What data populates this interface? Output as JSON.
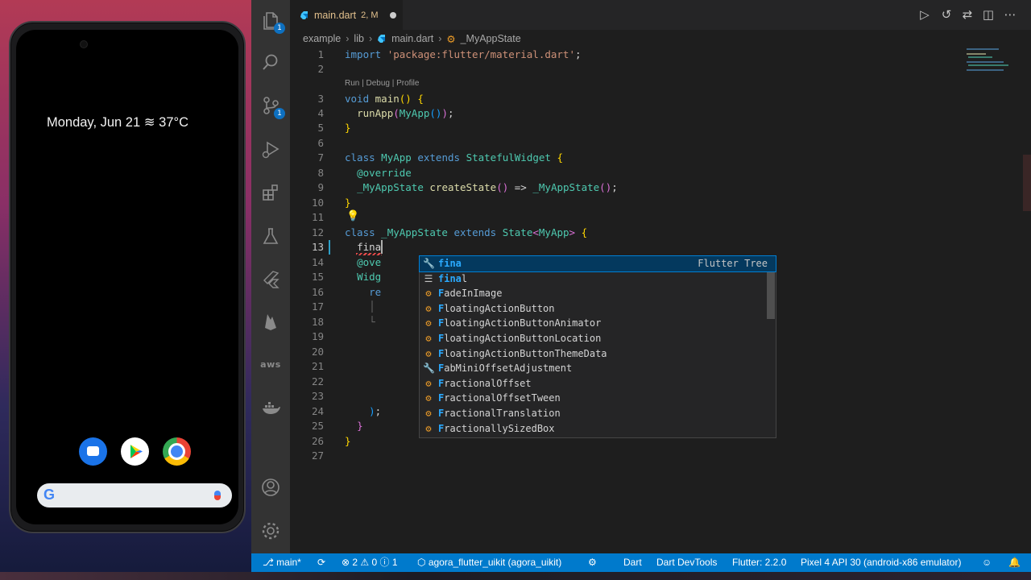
{
  "phone": {
    "date_weather": "Monday, Jun 21 ≋ 37°C",
    "dock_apps": [
      "messages-icon",
      "play-store-icon",
      "chrome-icon"
    ],
    "search_logo": "G"
  },
  "activity_bar": {
    "explorer_badge": "1",
    "source_control_badge": "1",
    "aws_label": "aws"
  },
  "editor_tab": {
    "filename": "main.dart",
    "status": "2, M"
  },
  "breadcrumb": [
    "example",
    "lib",
    "main.dart",
    "_MyAppState"
  ],
  "code": {
    "line_numbers": [
      "1",
      "2",
      "3",
      "4",
      "5",
      "6",
      "7",
      "8",
      "9",
      "10",
      "11",
      "12",
      "13",
      "14",
      "15",
      "16",
      "17",
      "18",
      "19",
      "20",
      "21",
      "22",
      "23",
      "24",
      "25",
      "26",
      "27"
    ],
    "codelens": "Run | Debug | Profile",
    "line1_import": "import",
    "line1_string": "'package:flutter/material.dart'",
    "line3_void": "void",
    "line3_main": "main",
    "line4_runapp": "runApp",
    "line4_myapp": "MyApp",
    "line7_class": "class",
    "line7_name": "MyApp",
    "line7_extends": "extends",
    "line7_super": "StatefulWidget",
    "line8_override": "@override",
    "line9_type": "_MyAppState",
    "line9_method": "createState",
    "line9_arrow": "=>",
    "line9_ctor": "_MyAppState",
    "line12_class": "class",
    "line12_name": "_MyAppState",
    "line12_extends": "extends",
    "line12_super": "State",
    "line12_generic": "MyApp",
    "line13_typed": "fina",
    "line14_partial": "@ove",
    "line15_partial": "Widg",
    "line16_partial": "re"
  },
  "suggestions": {
    "items": [
      {
        "icon": "wrench",
        "pre": "",
        "hl": "fina",
        "post": "",
        "detail": "Flutter Tree"
      },
      {
        "icon": "keyword",
        "pre": "",
        "hl": "fina",
        "post": "l",
        "detail": ""
      },
      {
        "icon": "class",
        "pre": "",
        "hl": "F",
        "post": "adeInImage",
        "detail": ""
      },
      {
        "icon": "class",
        "pre": "",
        "hl": "F",
        "post": "loatingActionButton",
        "detail": ""
      },
      {
        "icon": "class",
        "pre": "",
        "hl": "F",
        "post": "loatingActionButtonAnimator",
        "detail": ""
      },
      {
        "icon": "class",
        "pre": "",
        "hl": "F",
        "post": "loatingActionButtonLocation",
        "detail": ""
      },
      {
        "icon": "class",
        "pre": "",
        "hl": "F",
        "post": "loatingActionButtonThemeData",
        "detail": ""
      },
      {
        "icon": "wrench",
        "pre": "",
        "hl": "F",
        "post": "abMiniOffsetAdjustment",
        "detail": ""
      },
      {
        "icon": "class",
        "pre": "",
        "hl": "F",
        "post": "ractionalOffset",
        "detail": ""
      },
      {
        "icon": "class",
        "pre": "",
        "hl": "F",
        "post": "ractionalOffsetTween",
        "detail": ""
      },
      {
        "icon": "class",
        "pre": "",
        "hl": "F",
        "post": "ractionalTranslation",
        "detail": ""
      },
      {
        "icon": "class",
        "pre": "",
        "hl": "F",
        "post": "ractionallySizedBox",
        "detail": ""
      }
    ]
  },
  "status_bar": {
    "branch": "main*",
    "problems": "⊗ 2 ⚠ 0 ⓘ 1",
    "project": "agora_flutter_uikit (agora_uikit)",
    "language": "Dart",
    "devtools": "Dart DevTools",
    "flutter": "Flutter: 2.2.0",
    "device": "Pixel 4 API 30 (android-x86 emulator)"
  },
  "colors": {
    "status_bar": "#007acc",
    "activity_bar": "#333333",
    "editor_bg": "#1e1e1e",
    "selected_suggestion": "#04395e"
  }
}
